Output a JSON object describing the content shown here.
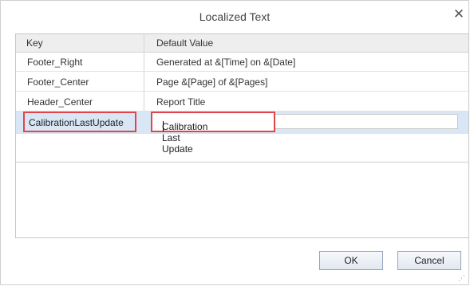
{
  "dialog": {
    "title": "Localized Text",
    "close_icon": "close-icon"
  },
  "grid": {
    "columns": [
      "Key",
      "Default Value"
    ],
    "rows": [
      {
        "key": "Footer_Right",
        "value": "Generated at &[Time] on &[Date]"
      },
      {
        "key": "Footer_Center",
        "value": "Page &[Page] of &[Pages]"
      },
      {
        "key": "Header_Center",
        "value": "Report Title"
      },
      {
        "key": "CalibrationLastUpdate",
        "value": "Calibration Last Update"
      }
    ]
  },
  "buttons": {
    "ok_label": "OK",
    "cancel_label": "Cancel"
  },
  "colors": {
    "highlight": "#e0454a",
    "selected_row": "#d9e6f5"
  }
}
